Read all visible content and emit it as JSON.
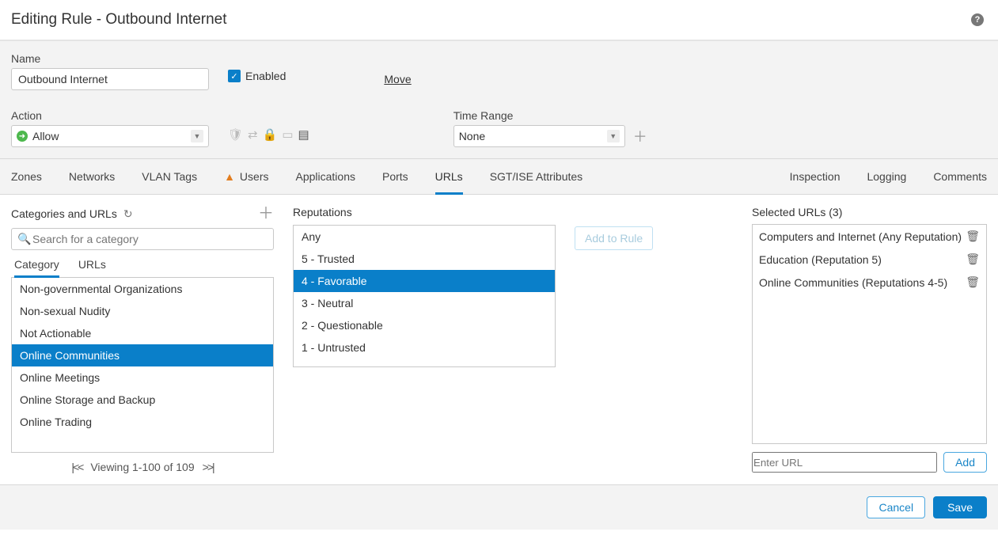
{
  "header": {
    "title": "Editing Rule - Outbound Internet"
  },
  "form": {
    "name_label": "Name",
    "name_value": "Outbound Internet",
    "enabled_label": "Enabled",
    "enabled_checked": true,
    "move_label": "Move",
    "action_label": "Action",
    "action_value": "Allow",
    "timerange_label": "Time Range",
    "timerange_value": "None"
  },
  "tabs": {
    "left": [
      "Zones",
      "Networks",
      "VLAN Tags",
      "Users",
      "Applications",
      "Ports",
      "URLs",
      "SGT/ISE Attributes"
    ],
    "right": [
      "Inspection",
      "Logging",
      "Comments"
    ],
    "users_warning": true,
    "selected": "URLs"
  },
  "categories_panel": {
    "title": "Categories and URLs",
    "search_placeholder": "Search for a category",
    "subtabs": [
      "Category",
      "URLs"
    ],
    "selected_subtab": "Category",
    "items": [
      "Non-governmental Organizations",
      "Non-sexual Nudity",
      "Not Actionable",
      "Online Communities",
      "Online Meetings",
      "Online Storage and Backup",
      "Online Trading"
    ],
    "selected_item": "Online Communities",
    "pager_text": "Viewing 1-100 of 109"
  },
  "reputations_panel": {
    "title": "Reputations",
    "items": [
      "Any",
      "5 - Trusted",
      "4 - Favorable",
      "3 - Neutral",
      "2 - Questionable",
      "1 - Untrusted"
    ],
    "selected_item": "4 - Favorable"
  },
  "add_to_rule_label": "Add to Rule",
  "selected_panel": {
    "title": "Selected URLs (3)",
    "items": [
      "Computers and Internet (Any Reputation)",
      "Education (Reputation 5)",
      "Online Communities (Reputations 4-5)"
    ],
    "enter_url_placeholder": "Enter URL",
    "add_label": "Add"
  },
  "footer": {
    "cancel_label": "Cancel",
    "save_label": "Save"
  }
}
